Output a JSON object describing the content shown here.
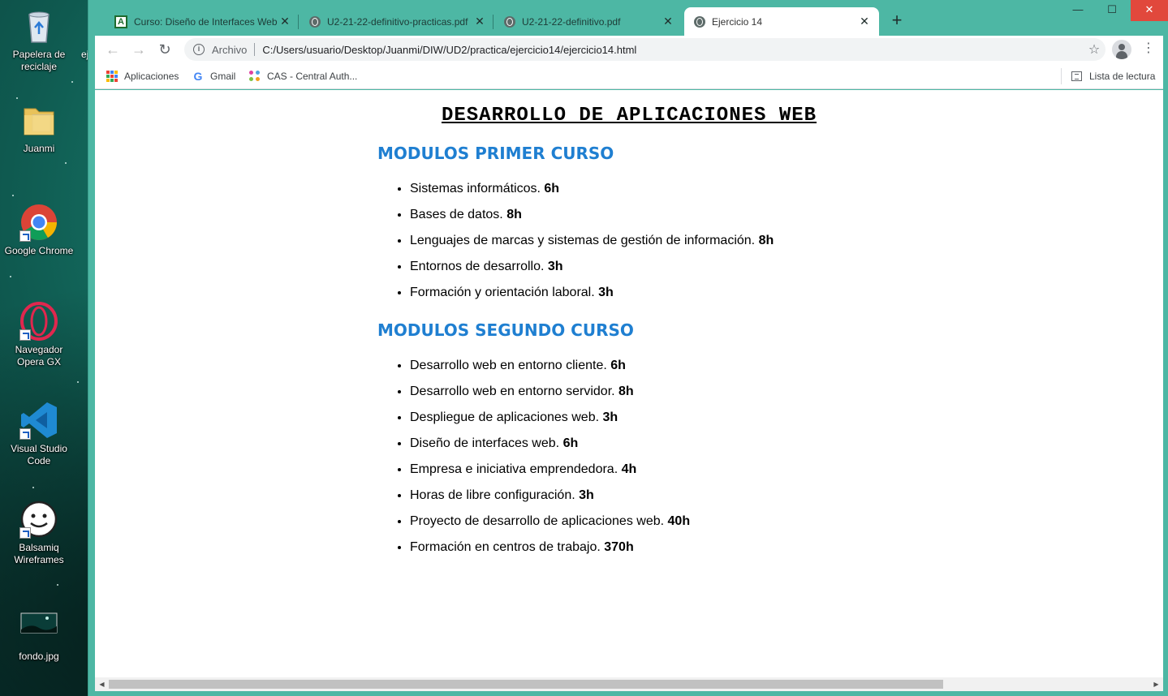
{
  "desktop": {
    "icons": [
      {
        "label": "Papelera de reciclaje",
        "icon": "recycle-bin-icon"
      },
      {
        "label": "Juanmi",
        "icon": "folder-icon"
      },
      {
        "label": "Google Chrome",
        "icon": "chrome-icon"
      },
      {
        "label": "Navegador Opera GX",
        "icon": "opera-icon"
      },
      {
        "label": "Visual Studio Code",
        "icon": "vscode-icon"
      },
      {
        "label": "Balsamiq Wireframes",
        "icon": "balsamiq-icon"
      },
      {
        "label": "fondo.jpg",
        "icon": "image-icon"
      }
    ],
    "cut_label": "ej"
  },
  "browser": {
    "tabs": [
      {
        "title": "Curso: Diseño de Interfaces Web",
        "active": false
      },
      {
        "title": "U2-21-22-definitivo-practicas.pdf",
        "active": false
      },
      {
        "title": "U2-21-22-definitivo.pdf",
        "active": false
      },
      {
        "title": "Ejercicio 14",
        "active": true
      }
    ],
    "address": {
      "scheme_label": "Archivo",
      "url": "C:/Users/usuario/Desktop/Juanmi/DIW/UD2/practica/ejercicio14/ejercicio14.html"
    },
    "bookmarks": [
      {
        "label": "Aplicaciones"
      },
      {
        "label": "Gmail"
      },
      {
        "label": "CAS - Central Auth..."
      }
    ],
    "reading_list_label": "Lista de lectura",
    "window_controls": {
      "minimize": "—",
      "maximize": "☐",
      "close": "✕"
    }
  },
  "page": {
    "title": "DESARROLLO DE APLICACIONES WEB",
    "sections": [
      {
        "title": "MODULOS PRIMER CURSO",
        "modules": [
          {
            "name": "Sistemas informáticos.",
            "hours": "6h"
          },
          {
            "name": "Bases de datos.",
            "hours": "8h"
          },
          {
            "name": "Lenguajes de marcas y sistemas de gestión de información.",
            "hours": "8h"
          },
          {
            "name": "Entornos de desarrollo.",
            "hours": "3h"
          },
          {
            "name": "Formación y orientación laboral.",
            "hours": "3h"
          }
        ]
      },
      {
        "title": "MODULOS SEGUNDO CURSO",
        "modules": [
          {
            "name": "Desarrollo web en entorno cliente.",
            "hours": "6h"
          },
          {
            "name": "Desarrollo web en entorno servidor.",
            "hours": "8h"
          },
          {
            "name": "Despliegue de aplicaciones web.",
            "hours": "3h"
          },
          {
            "name": "Diseño de interfaces web.",
            "hours": "6h"
          },
          {
            "name": "Empresa e iniciativa emprendedora.",
            "hours": "4h"
          },
          {
            "name": "Horas de libre configuración.",
            "hours": "3h"
          },
          {
            "name": "Proyecto de desarrollo de aplicaciones web.",
            "hours": "40h"
          },
          {
            "name": "Formación en centros de trabajo.",
            "hours": "370h"
          }
        ]
      }
    ]
  },
  "colors": {
    "window_frame": "#4db7a4",
    "section_heading": "#1f7fd1",
    "close_button": "#e1483c"
  }
}
